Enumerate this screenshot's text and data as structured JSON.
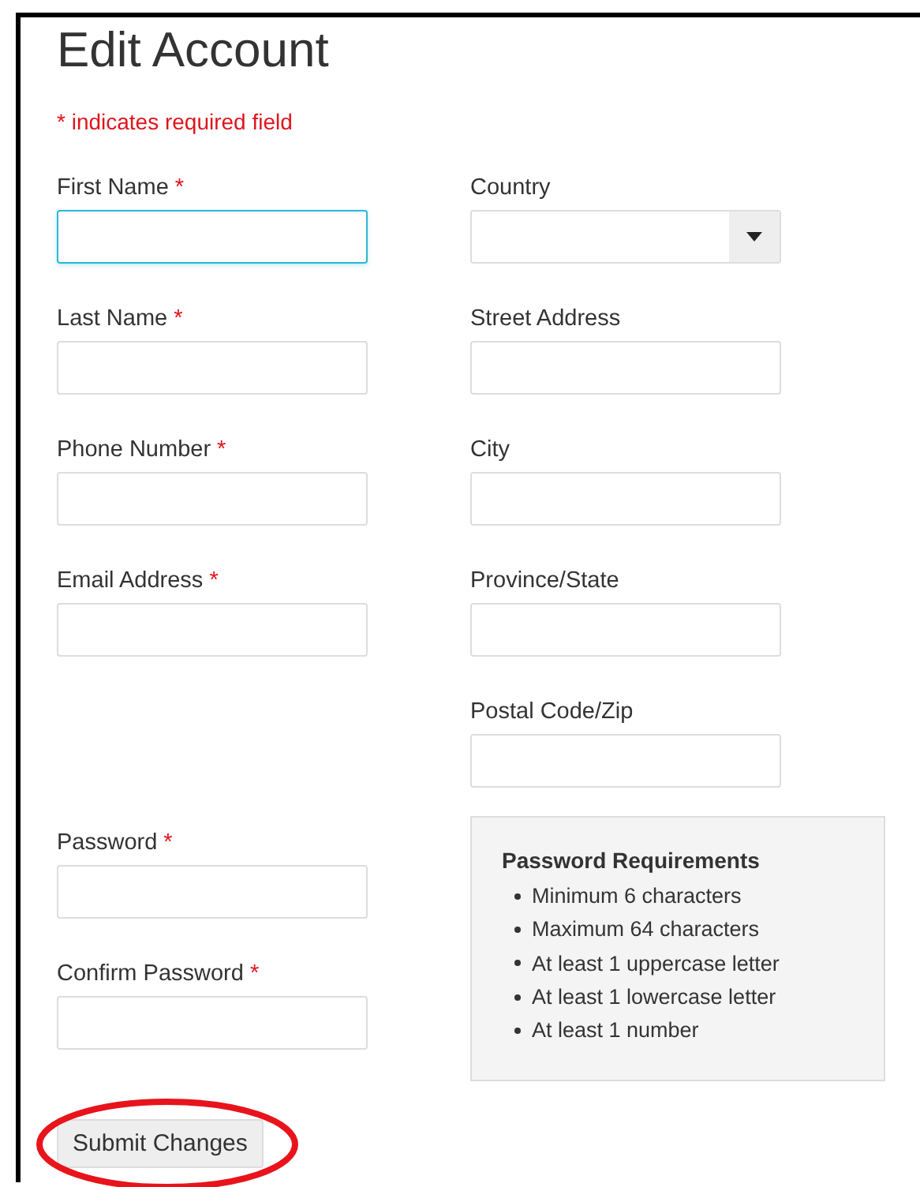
{
  "title": "Edit Account",
  "required_note": "* indicates required field",
  "personal_fields": [
    {
      "label": "First Name",
      "required": true,
      "focused": true
    },
    {
      "label": "Last Name",
      "required": true,
      "focused": false
    },
    {
      "label": "Phone Number",
      "required": true,
      "focused": false
    },
    {
      "label": "Email Address",
      "required": true,
      "focused": false
    }
  ],
  "address_fields": [
    {
      "label": "Country",
      "required": false,
      "kind": "select",
      "focused": false
    },
    {
      "label": "Street Address",
      "required": false,
      "kind": "text",
      "focused": false
    },
    {
      "label": "City",
      "required": false,
      "kind": "text",
      "focused": false
    },
    {
      "label": "Province/State",
      "required": false,
      "kind": "text",
      "focused": false
    },
    {
      "label": "Postal Code/Zip",
      "required": false,
      "kind": "text",
      "focused": false
    }
  ],
  "password_fields": [
    {
      "label": "Password",
      "required": true,
      "focused": false
    },
    {
      "label": "Confirm Password",
      "required": true,
      "focused": false
    }
  ],
  "password_requirements": {
    "title": "Password Requirements",
    "items": [
      "Minimum 6 characters",
      "Maximum 64 characters",
      "At least 1 uppercase letter",
      "At least 1 lowercase letter",
      "At least 1 number"
    ]
  },
  "submit_button": "Submit Changes",
  "asterisk": "*"
}
